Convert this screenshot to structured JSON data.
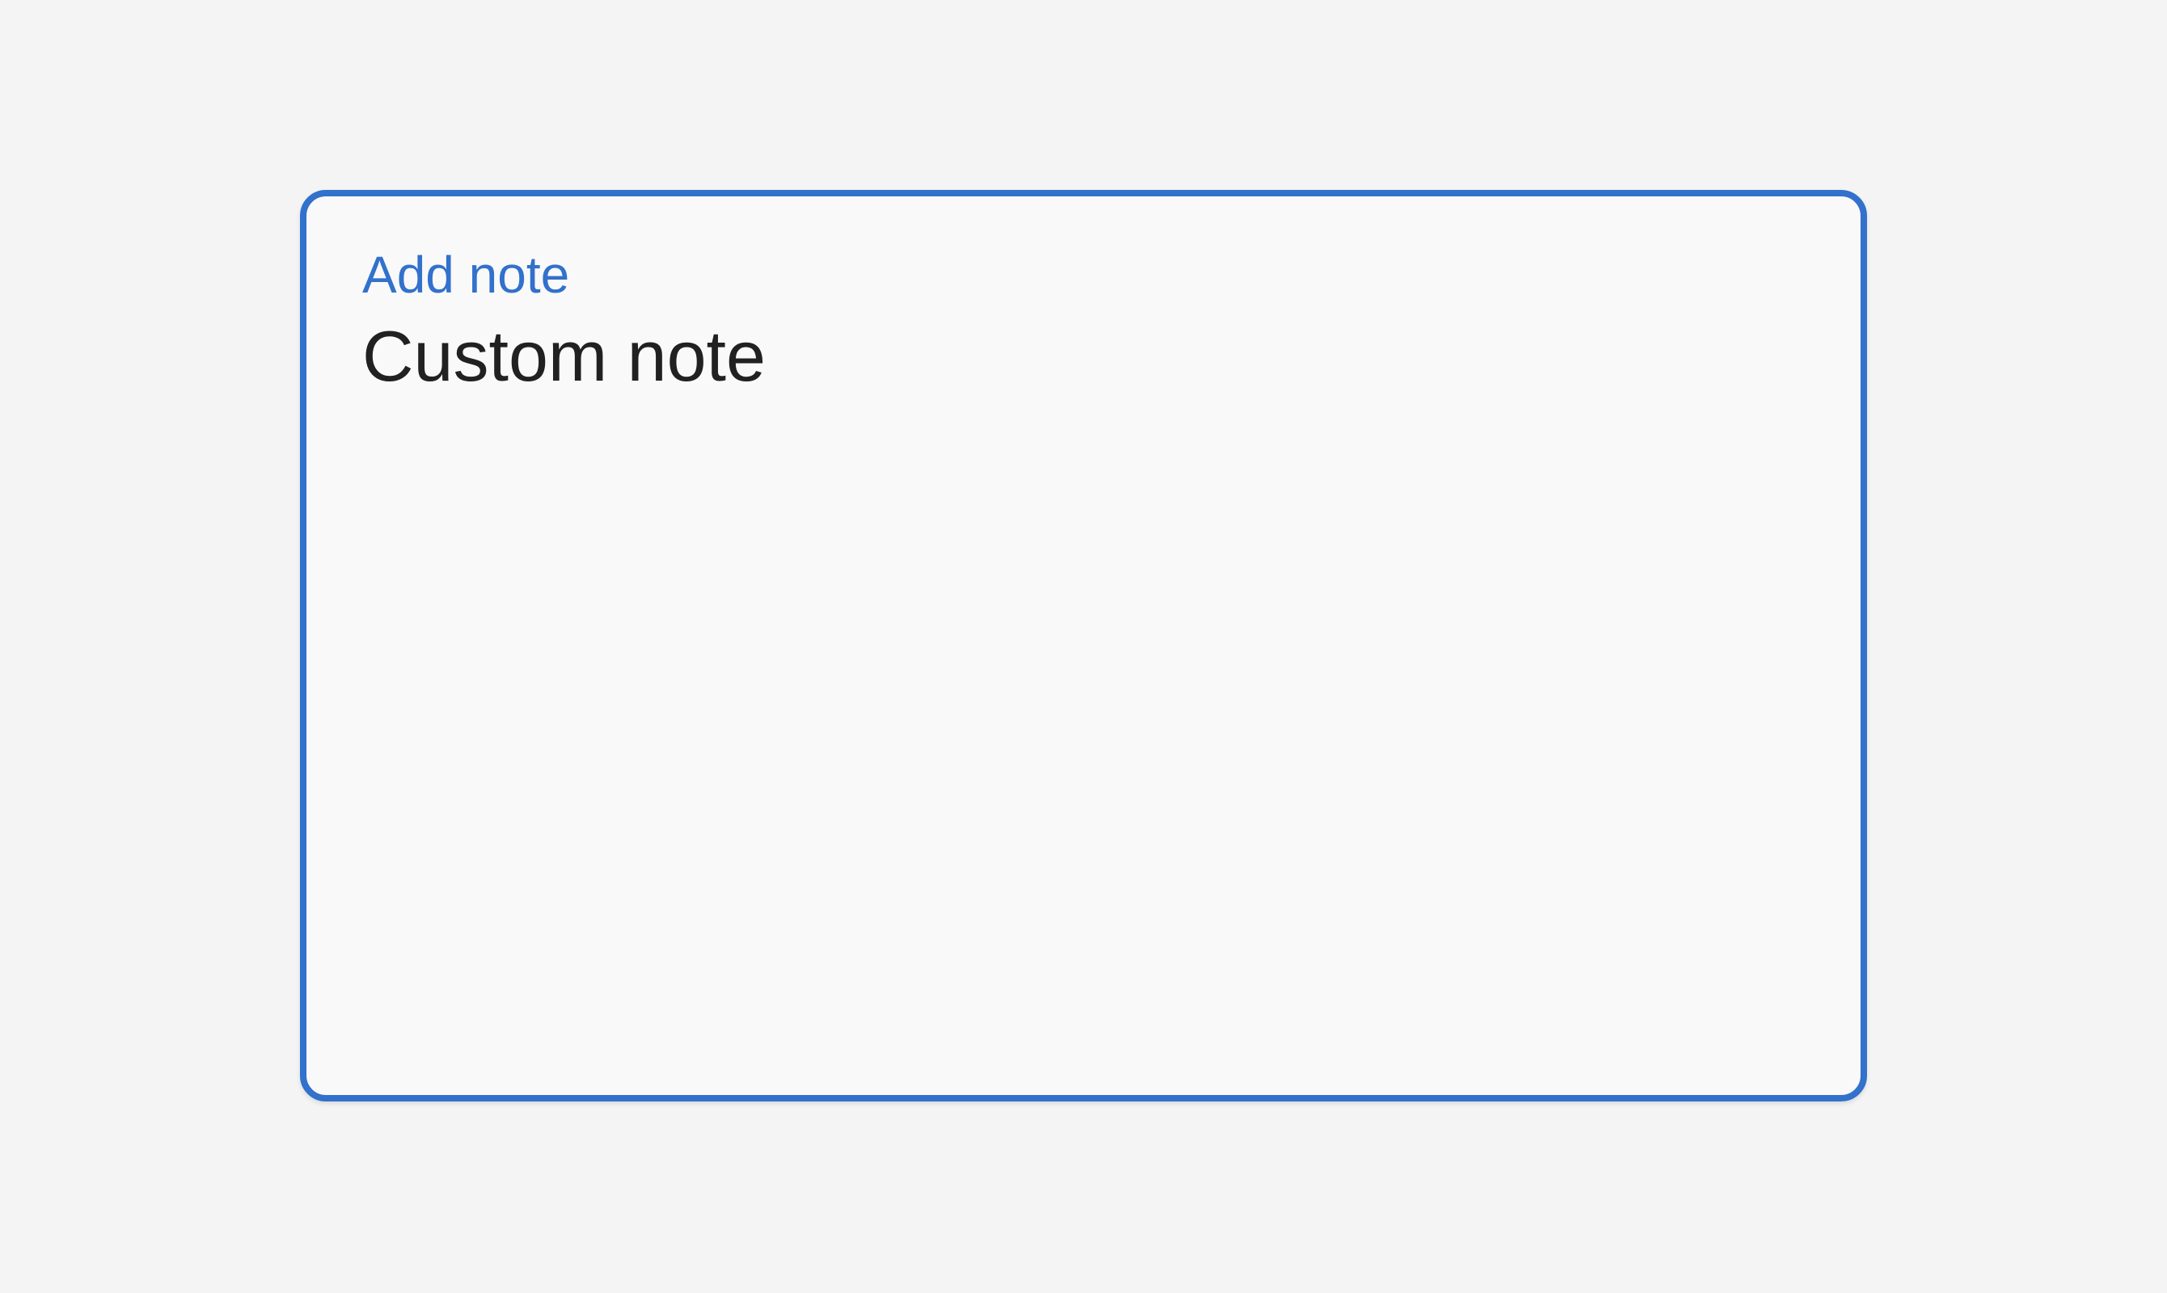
{
  "note": {
    "label": "Add note",
    "value": "Custom note",
    "state": "focused"
  },
  "colors": {
    "accent": "#3271cc",
    "text": "#212121",
    "field_background": "#f9f9f9",
    "page_background": "#f4f4f4"
  }
}
